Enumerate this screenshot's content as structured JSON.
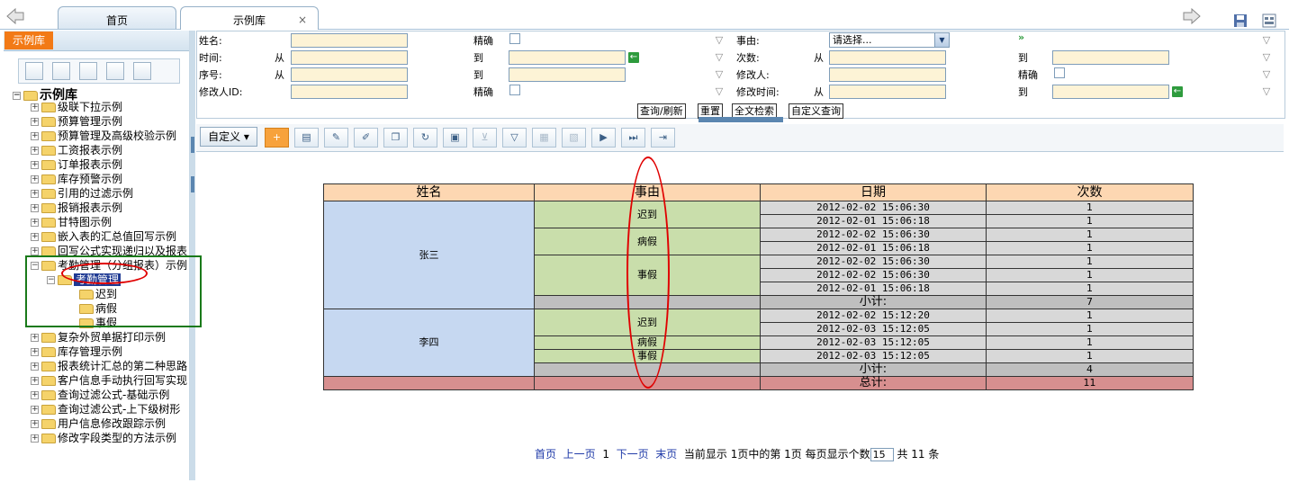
{
  "tabs": [
    "首页",
    "示例库"
  ],
  "tab_close": "×",
  "sidebar": {
    "title": "示例库",
    "root": "示例库",
    "items": [
      "级联下拉示例",
      "预算管理示例",
      "预算管理及高级校验示例",
      "工资报表示例",
      "订单报表示例",
      "库存预警示例",
      "引用的过滤示例",
      "报销报表示例",
      "甘特图示例",
      "嵌入表的汇总值回写示例",
      "回写公式实现递归以及报表",
      "考勤管理（分组报表）示例"
    ],
    "sub_selected": "考勤管理",
    "leaves": [
      "迟到",
      "病假",
      "事假"
    ],
    "items_after": [
      "复杂外贸单据打印示例",
      "库存管理示例",
      "报表统计汇总的第二种思路",
      "客户信息手动执行回写实现",
      "查询过滤公式-基础示例",
      "查询过滤公式-上下级树形",
      "用户信息修改跟踪示例",
      "修改字段类型的方法示例"
    ]
  },
  "query": {
    "name_label": "姓名:",
    "exact": "精确",
    "time_label": "时间:",
    "from": "从",
    "to": "到",
    "seq_label": "序号:",
    "modifier_id_label": "修改人ID:",
    "reason_label": "事由:",
    "reason_placeholder": "请选择...",
    "count_label": "次数:",
    "modifier_label": "修改人:",
    "modtime_label": "修改时间:",
    "buttons": [
      "查询/刷新",
      "重置",
      "全文检索",
      "自定义查询"
    ]
  },
  "toolbar": {
    "custom": "自定义"
  },
  "report": {
    "headers": [
      "姓名",
      "事由",
      "日期",
      "次数"
    ],
    "groups": [
      {
        "name": "张三",
        "reasons": [
          {
            "reason": "迟到",
            "rows": [
              [
                "2012-02-02 15:06:30",
                "1"
              ],
              [
                "2012-02-01 15:06:18",
                "1"
              ]
            ]
          },
          {
            "reason": "病假",
            "rows": [
              [
                "2012-02-02 15:06:30",
                "1"
              ],
              [
                "2012-02-01 15:06:18",
                "1"
              ]
            ]
          },
          {
            "reason": "事假",
            "rows": [
              [
                "2012-02-02 15:06:30",
                "1"
              ],
              [
                "2012-02-02 15:06:30",
                "1"
              ],
              [
                "2012-02-01 15:06:18",
                "1"
              ]
            ]
          }
        ],
        "subtotal_label": "小计:",
        "subtotal": "7"
      },
      {
        "name": "李四",
        "reasons": [
          {
            "reason": "迟到",
            "rows": [
              [
                "2012-02-02 15:12:20",
                "1"
              ],
              [
                "2012-02-03 15:12:05",
                "1"
              ]
            ]
          },
          {
            "reason": "病假",
            "rows": [
              [
                "2012-02-03 15:12:05",
                "1"
              ]
            ]
          },
          {
            "reason": "事假",
            "rows": [
              [
                "2012-02-03 15:12:05",
                "1"
              ]
            ]
          }
        ],
        "subtotal_label": "小计:",
        "subtotal": "4"
      }
    ],
    "total_label": "总计:",
    "total": "11"
  },
  "pager": {
    "first": "首页",
    "prev": "上一页",
    "page": "1",
    "next": "下一页",
    "last": "末页",
    "info": "当前显示 1页中的第 1页  每页显示个数",
    "page_size": "15",
    "count": "共 11 条"
  }
}
